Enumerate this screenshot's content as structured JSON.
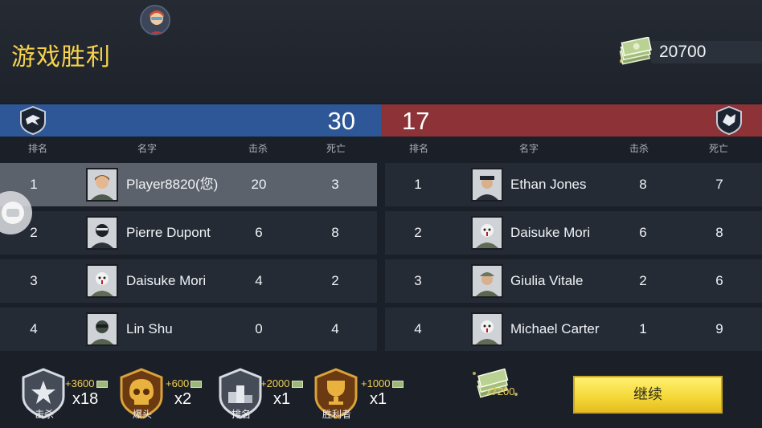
{
  "header": {
    "title": "游戏胜利",
    "money": "20700"
  },
  "teams": {
    "left": {
      "score": "30",
      "color": "#2e5798"
    },
    "right": {
      "score": "17",
      "color": "#8d3236"
    }
  },
  "columns": {
    "rank": "排名",
    "name": "名字",
    "kills": "击杀",
    "deaths": "死亡"
  },
  "left_rows": [
    {
      "rank": "1",
      "name": "Player8820(您)",
      "kills": "20",
      "deaths": "3"
    },
    {
      "rank": "2",
      "name": "Pierre Dupont",
      "kills": "6",
      "deaths": "8"
    },
    {
      "rank": "3",
      "name": "Daisuke Mori",
      "kills": "4",
      "deaths": "2"
    },
    {
      "rank": "4",
      "name": "Lin Shu",
      "kills": "0",
      "deaths": "4"
    }
  ],
  "right_rows": [
    {
      "rank": "1",
      "name": "Ethan Jones",
      "kills": "8",
      "deaths": "7"
    },
    {
      "rank": "2",
      "name": "Daisuke Mori",
      "kills": "6",
      "deaths": "8"
    },
    {
      "rank": "3",
      "name": "Giulia Vitale",
      "kills": "2",
      "deaths": "6"
    },
    {
      "rank": "4",
      "name": "Michael Carter",
      "kills": "1",
      "deaths": "9"
    }
  ],
  "rewards": [
    {
      "label": "击杀",
      "bonus": "+3600",
      "mult": "x18",
      "icon": "star-badge-icon"
    },
    {
      "label": "爆头",
      "bonus": "+600",
      "mult": "x2",
      "icon": "skull-badge-icon"
    },
    {
      "label": "排名",
      "bonus": "+2000",
      "mult": "x1",
      "icon": "rank-badge-icon"
    },
    {
      "label": "胜利者",
      "bonus": "+1000",
      "mult": "x1",
      "icon": "trophy-badge-icon"
    }
  ],
  "total_reward": "x7200",
  "continue_label": "继续"
}
